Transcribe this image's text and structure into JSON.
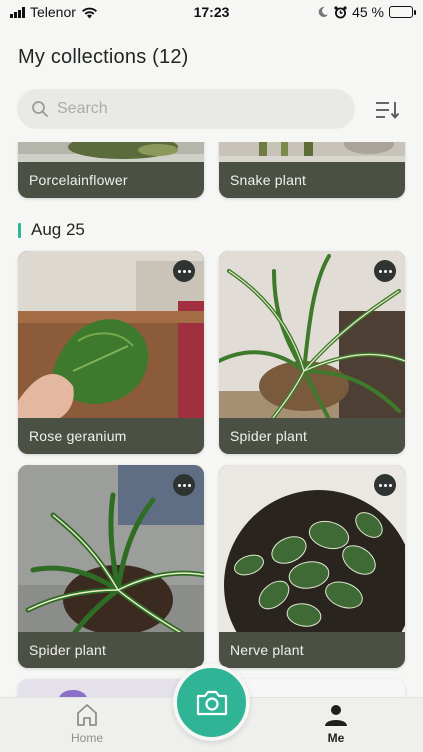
{
  "status_bar": {
    "carrier": "Telenor",
    "time": "17:23",
    "battery": "45 %",
    "battery_level": 0.45
  },
  "header": {
    "title": "My collections (12)",
    "search_placeholder": "Search"
  },
  "collections": {
    "top_cards": [
      {
        "name": "Porcelainflower"
      },
      {
        "name": "Snake plant"
      }
    ],
    "groups": [
      {
        "date": "Aug 25",
        "cards": [
          {
            "name": "Rose geranium"
          },
          {
            "name": "Spider plant"
          },
          {
            "name": "Spider plant"
          },
          {
            "name": "Nerve plant"
          }
        ]
      }
    ]
  },
  "tab_bar": {
    "home_label": "Home",
    "me_label": "Me"
  },
  "colors": {
    "accent": "#2fb496",
    "card_label_bg": "#4b5044"
  },
  "icons": [
    "signal-icon",
    "wifi-icon",
    "moon-icon",
    "alarm-icon",
    "battery-icon",
    "search-icon",
    "sort-icon",
    "more-icon",
    "home-icon",
    "person-icon",
    "camera-icon"
  ]
}
